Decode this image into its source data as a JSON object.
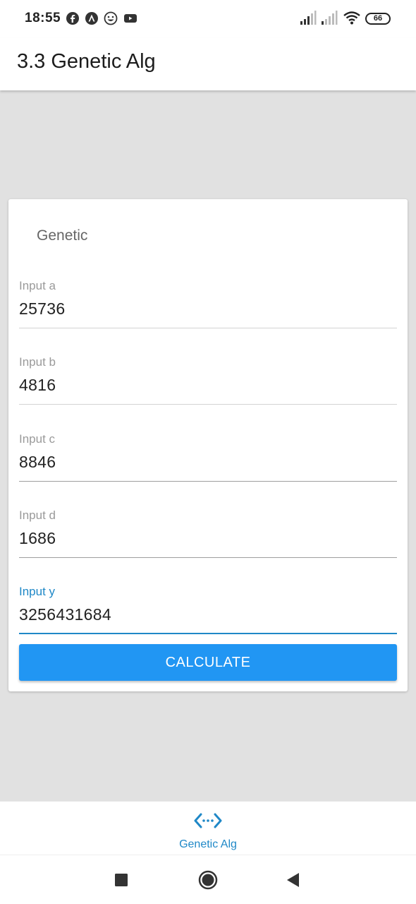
{
  "status_bar": {
    "time": "18:55",
    "battery": "66",
    "icons": [
      "facebook-icon",
      "arch-icon",
      "emoji-icon",
      "youtube-icon",
      "signal-icon",
      "signal-icon",
      "wifi-icon",
      "battery-icon"
    ]
  },
  "app_bar": {
    "title": "3.3 Genetic Alg"
  },
  "card": {
    "title": "Genetic",
    "fields": [
      {
        "label": "Input a",
        "value": "25736"
      },
      {
        "label": "Input b",
        "value": "4816"
      },
      {
        "label": "Input c",
        "value": "8846"
      },
      {
        "label": "Input d",
        "value": "1686"
      },
      {
        "label": "Input y",
        "value": "3256431684"
      }
    ],
    "button_label": "CALCULATE"
  },
  "bottom_nav": {
    "items": [
      {
        "label": "Genetic Alg",
        "icon": "code-arrows-icon",
        "active": true
      }
    ]
  },
  "colors": {
    "accent": "#2196f3",
    "focus": "#1f88c7",
    "background": "#e1e1e1"
  }
}
